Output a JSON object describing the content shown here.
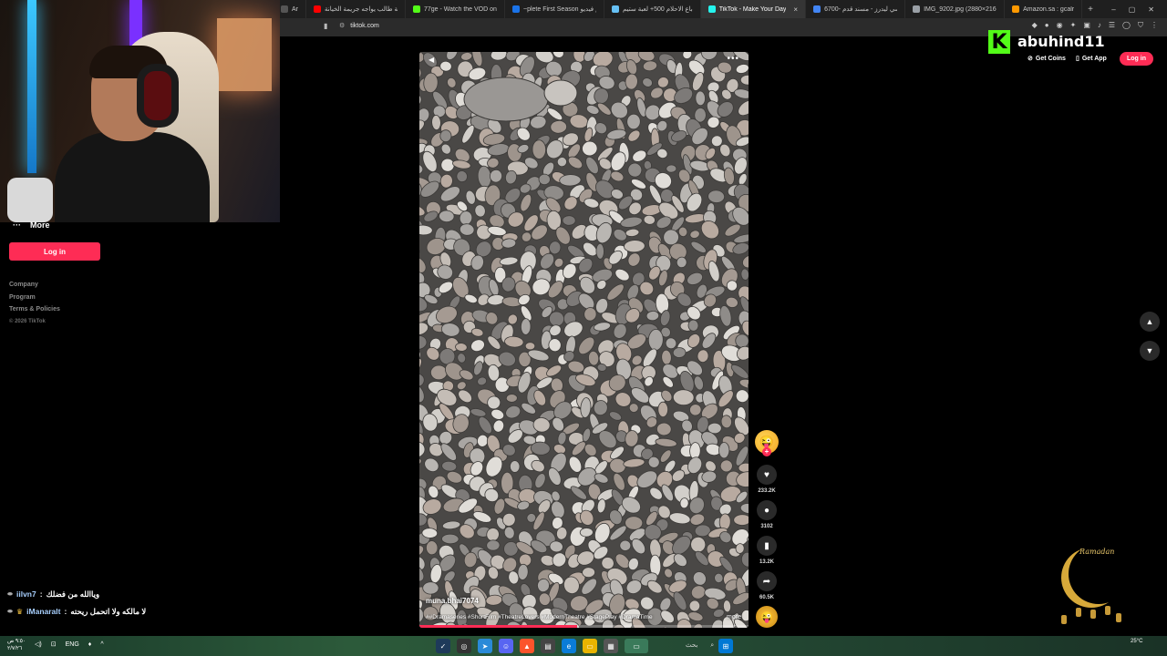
{
  "browser": {
    "tabs": [
      {
        "title": "Ar",
        "color": "#555555",
        "active": false
      },
      {
        "title": "قصة طالب يواجه جريمة الخيانة",
        "color": "#ff0000",
        "active": false
      },
      {
        "title": "77ge - Watch the VOD on Kick",
        "color": "#53fc18",
        "active": false
      },
      {
        "title": "~plete First Season برايم فيديو pc",
        "color": "#1a73e8",
        "active": false
      },
      {
        "title": "باع الاحلام 500+ لعبة ستيم",
        "color": "#66c0f4",
        "active": false
      },
      {
        "title": "TikTok - Make Your Day",
        "color": "#25f4ee",
        "active": true
      },
      {
        "title": "6700- كراسي ليدرز - مسند قدم",
        "color": "#4285f4",
        "active": false
      },
      {
        "title": "IMG_9202.jpg (2880×2160)",
        "color": "#9aa0a6",
        "active": false
      },
      {
        "title": "Amazon.sa : gcalr",
        "color": "#ff9900",
        "active": false
      }
    ],
    "tab_close": "×",
    "new_tab": "+",
    "window_buttons": [
      "–",
      "▢",
      "✕"
    ],
    "url": "tiktok.com"
  },
  "sidebar": {
    "more_label": "More",
    "login_label": "Log in",
    "footer": {
      "company": "Company",
      "program": "Program",
      "terms": "Terms & Policies",
      "copyright": "© 2026 TikTok"
    }
  },
  "header": {
    "kick_letter": "K",
    "streamer_name": "abuhind11",
    "get_coins": "Get Coins",
    "get_app": "Get App",
    "login": "Log in"
  },
  "video": {
    "author": "muna.bhai7074",
    "tags": "##Dramaseries #ShortFilm #TheatreLovers #ModernTheatre #StagePlay #DramaTime",
    "more": "more",
    "menu_dots": "•••",
    "progress": 0.48
  },
  "actions": {
    "likes": "233.2K",
    "comments": "3102",
    "saves": "13.2K",
    "shares": "60.5K"
  },
  "chat": [
    {
      "user": "iilvn7",
      "separator": ":",
      "message": "وياالله من فضلك"
    },
    {
      "user": "iManaralt",
      "separator": ":",
      "message": "لا مالكه ولا اتحمل ريحته"
    }
  ],
  "decoration": {
    "ramadan_text": "Ramadan"
  },
  "taskbar": {
    "time": "٩:٥٠ ص",
    "date": "٢/٧/٢٦",
    "lang": "ENG",
    "search": "بحث",
    "weather_temp": "25°C"
  },
  "colors": {
    "tiktok_red": "#fe2c55",
    "kick_green": "#53fc18"
  }
}
